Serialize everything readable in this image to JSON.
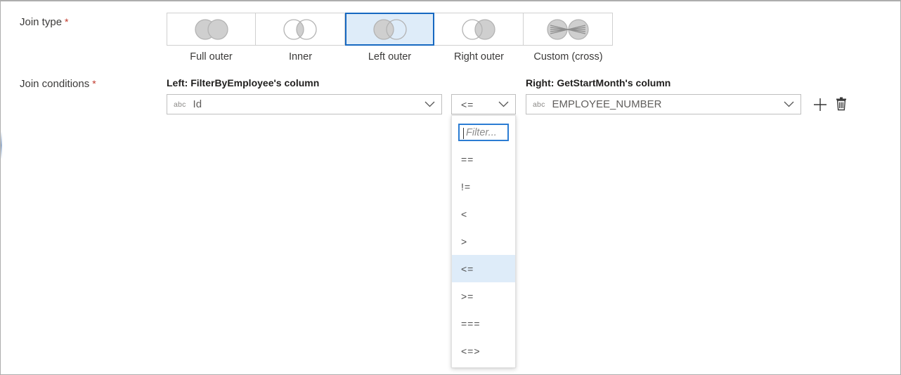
{
  "form": {
    "join_type_label": "Join type",
    "join_conditions_label": "Join conditions",
    "required_marker": "*"
  },
  "join_type": {
    "selected": "Left outer",
    "options": [
      {
        "label": "Full outer",
        "icon": "venn-full-outer-icon",
        "selected": false
      },
      {
        "label": "Inner",
        "icon": "venn-inner-icon",
        "selected": false
      },
      {
        "label": "Left outer",
        "icon": "venn-left-outer-icon",
        "selected": true
      },
      {
        "label": "Right outer",
        "icon": "venn-right-outer-icon",
        "selected": false
      },
      {
        "label": "Custom (cross)",
        "icon": "venn-custom-cross-icon",
        "selected": false
      }
    ]
  },
  "join_conditions": {
    "left_header": "Left: FilterByEmployee's column",
    "right_header": "Right: GetStartMonth's column",
    "left_column": {
      "type_tag": "abc",
      "value": "Id"
    },
    "right_column": {
      "type_tag": "abc",
      "value": "EMPLOYEE_NUMBER"
    },
    "operator": {
      "value": "<="
    },
    "add_label": "+",
    "delete_label": "Delete"
  },
  "operator_dropdown": {
    "open": true,
    "filter_placeholder": "Filter...",
    "filter_value": "",
    "options": [
      {
        "label": "==",
        "selected": false
      },
      {
        "label": "!=",
        "selected": false
      },
      {
        "label": "<",
        "selected": false
      },
      {
        "label": ">",
        "selected": false
      },
      {
        "label": "<=",
        "selected": true
      },
      {
        "label": ">=",
        "selected": false
      },
      {
        "label": "===",
        "selected": false
      },
      {
        "label": "<=>",
        "selected": false
      }
    ]
  },
  "colors": {
    "accent": "#1668c1",
    "selection_fill": "#deecf9",
    "required": "#c0392b",
    "venn_fill": "#cfcfcf",
    "venn_stroke": "#b3b3b3"
  }
}
